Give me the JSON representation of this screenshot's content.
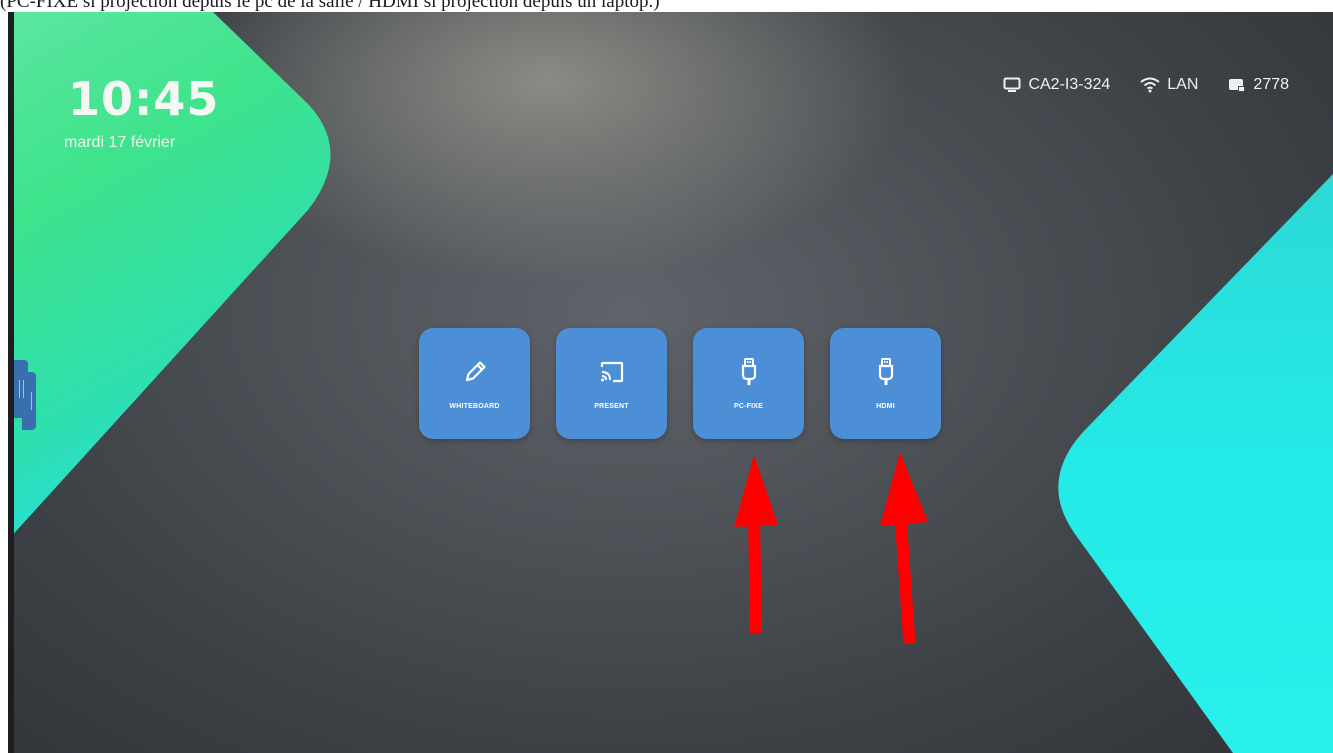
{
  "caption": "(PC-FIXE si projection depuis le pc de la salle / HDMI si projection depuis un laptop.)",
  "clock": {
    "time": "10:45",
    "date": "mardi 17 février"
  },
  "status": {
    "device_name": "CA2-I3-324",
    "network": "LAN",
    "cast_code": "2778"
  },
  "tiles": [
    {
      "label": "WHITEBOARD",
      "icon": "pencil-icon"
    },
    {
      "label": "PRESENT",
      "icon": "cast-icon"
    },
    {
      "label": "PC-FIXE",
      "icon": "usb-plug-icon"
    },
    {
      "label": "HDMI",
      "icon": "usb-plug-icon"
    }
  ],
  "colors": {
    "tile": "#4c8fd6",
    "accent_green": "#43e58d",
    "accent_cyan": "#22e8e6",
    "annotation_arrow": "#ff0000"
  },
  "annotations": {
    "arrows": [
      "PC-FIXE",
      "HDMI"
    ]
  }
}
